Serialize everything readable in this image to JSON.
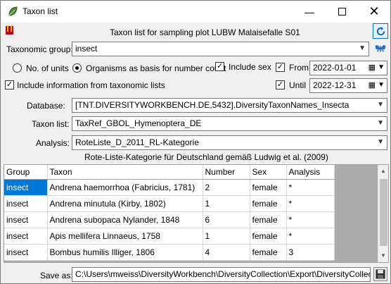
{
  "window": {
    "title": "Taxon list"
  },
  "header": {
    "caption": "Taxon list for sampling plot LUBW Malaisefalle S01"
  },
  "taxonomic_group": {
    "label": "Taxonomic group:",
    "value": "insect"
  },
  "options": {
    "no_of_units": "No. of units",
    "organisms_basis": "Organisms as basis for number count",
    "include_sex": "Include sex",
    "from_label": "From",
    "from_date": "2022-01-01",
    "include_taxonomic": "Include information from taxonomic lists",
    "until_label": "Until",
    "until_date": "2022-12-31"
  },
  "database": {
    "label": "Database:",
    "value": "[TNT.DIVERSITYWORKBENCH.DE,5432].DiversityTaxonNames_Insecta"
  },
  "taxon_list": {
    "label": "Taxon list:",
    "value": "TaxRef_GBOL_Hymenoptera_DE"
  },
  "analysis": {
    "label": "Analysis:",
    "value": "RoteListe_D_2011_RL-Kategorie",
    "description": "Rote-Liste-Kategorie für Deutschland gemäß Ludwig et al. (2009)"
  },
  "table": {
    "columns": [
      "Group",
      "Taxon",
      "Number",
      "Sex",
      "Analysis"
    ],
    "rows": [
      [
        "insect",
        "Andrena haemorrhoa (Fabricius, 1781)",
        "2",
        "female",
        "*"
      ],
      [
        "insect",
        "Andrena minutula (Kirby, 1802)",
        "1",
        "female",
        "*"
      ],
      [
        "insect",
        "Andrena subopaca Nylander, 1848",
        "6",
        "female",
        "*"
      ],
      [
        "insect",
        "Apis mellifera Linnaeus, 1758",
        "1",
        "female",
        "*"
      ],
      [
        "insect",
        "Bombus humilis Illiger, 1806",
        "4",
        "female",
        "3"
      ]
    ]
  },
  "save": {
    "label": "Save as:",
    "path": "C:\\Users\\mweiss\\DiversityWorkbench\\DiversityCollection\\Export\\DiversityCollection_Ta"
  }
}
